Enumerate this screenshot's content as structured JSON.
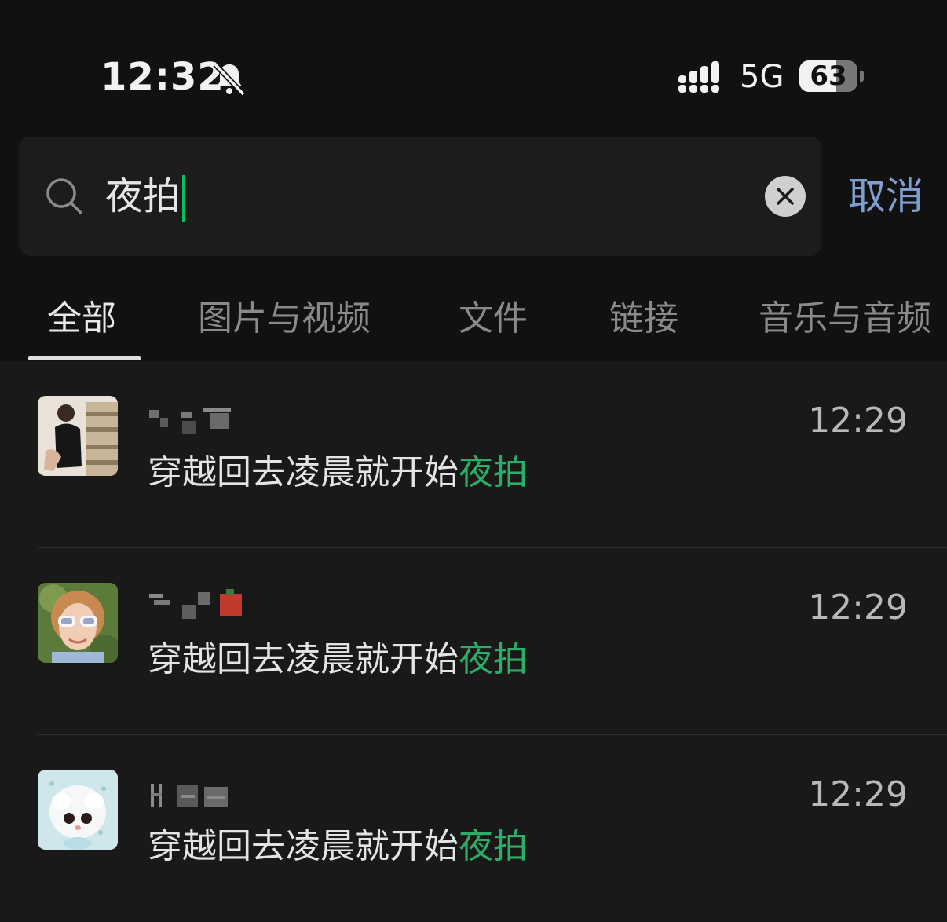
{
  "status_bar": {
    "time": "12:32",
    "network": "5G",
    "battery": "63",
    "battery_level": 0.63,
    "icons": [
      "bell-slash-icon",
      "signal-icon",
      "battery-icon"
    ]
  },
  "search": {
    "query": "夜拍",
    "cancel_label": "取消",
    "accent": "#07c160"
  },
  "tabs": [
    {
      "label": "全部",
      "active": true
    },
    {
      "label": "图片与视频",
      "active": false
    },
    {
      "label": "文件",
      "active": false
    },
    {
      "label": "链接",
      "active": false
    },
    {
      "label": "音乐与音频",
      "active": false
    }
  ],
  "results": [
    {
      "message_prefix": "穿越回去凌晨就开始",
      "message_highlight": "夜拍",
      "time": "12:29"
    },
    {
      "message_prefix": "穿越回去凌晨就开始",
      "message_highlight": "夜拍",
      "time": "12:29"
    },
    {
      "message_prefix": "穿越回去凌晨就开始",
      "message_highlight": "夜拍",
      "time": "12:29"
    }
  ],
  "colors": {
    "highlight": "#2bae67",
    "link": "#7f9fd0",
    "background": "#191919"
  }
}
